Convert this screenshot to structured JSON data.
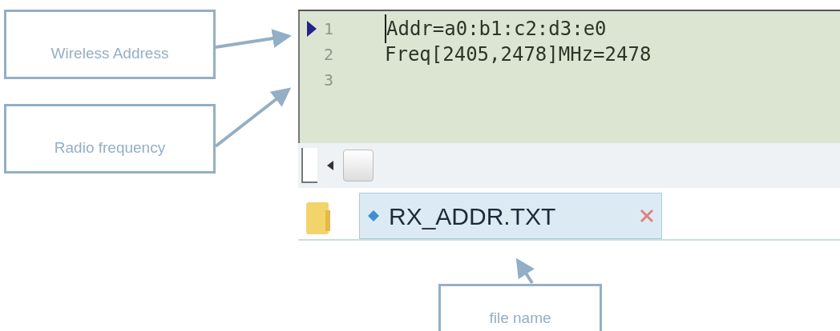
{
  "editor": {
    "lines": [
      {
        "number": "1",
        "text": "Addr=a0:b1:c2:d3:e0",
        "current": true
      },
      {
        "number": "2",
        "text": "Freq[2405,2478]MHz=2478",
        "current": false
      },
      {
        "number": "3",
        "current": false
      }
    ]
  },
  "tabs": [
    {
      "label": "RX_ADDR.TXT",
      "selected": true
    }
  ],
  "callouts": [
    {
      "text": "Wireless Address"
    },
    {
      "text": "Radio frequency"
    },
    {
      "text": "file name"
    }
  ]
}
